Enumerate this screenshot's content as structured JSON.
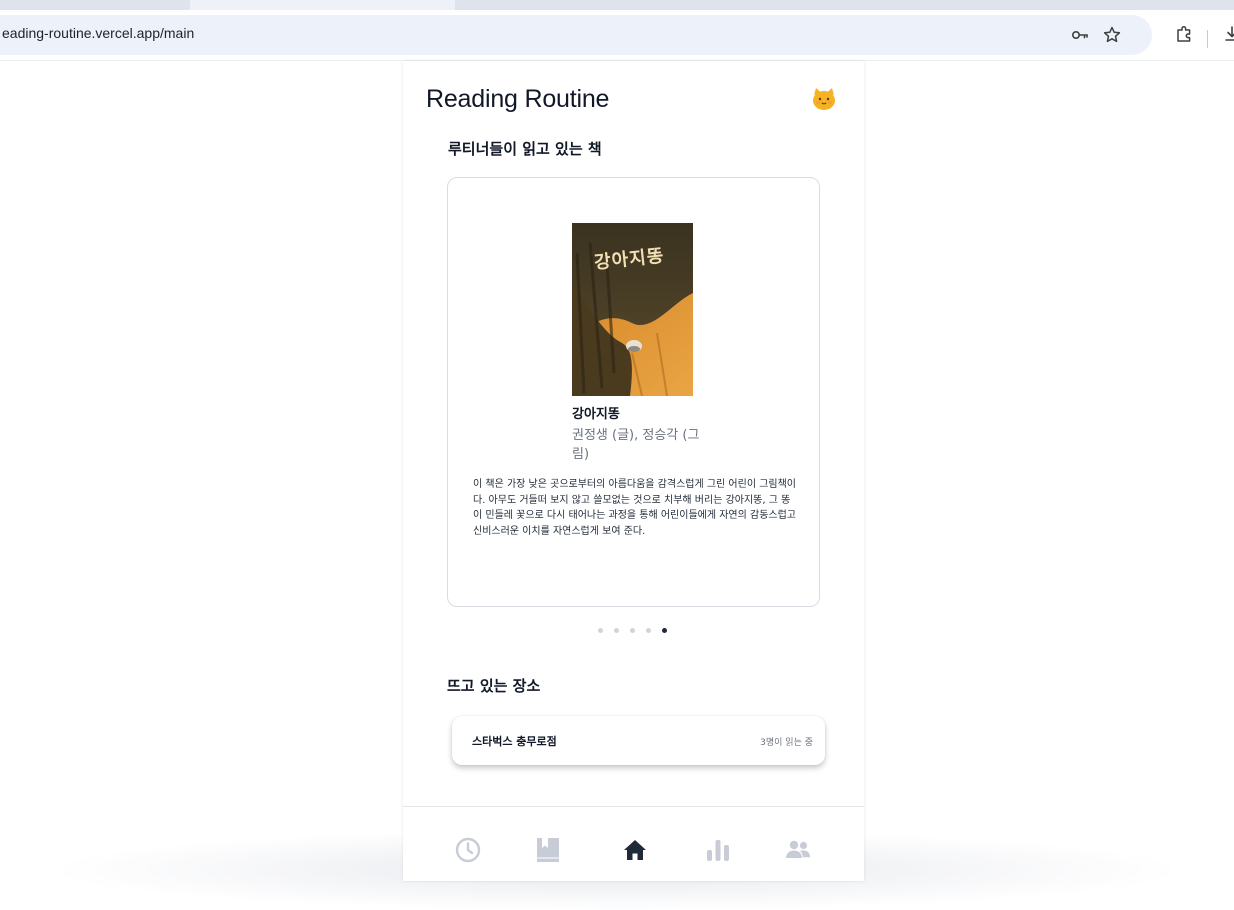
{
  "browser": {
    "url": "eading-routine.vercel.app/main",
    "icons": [
      "key-icon",
      "star-icon",
      "extensions-icon",
      "download-icon"
    ]
  },
  "app": {
    "title": "Reading Routine",
    "avatar_icon": "cat-face-icon",
    "accent_color": "#f5b323"
  },
  "reading_section": {
    "title": "루티너들이 읽고 있는 책",
    "book": {
      "cover_text": "강아지똥",
      "title": "강아지똥",
      "author": "권정생 (글), 정승각 (그림)",
      "description": "이 책은 가장 낮은 곳으로부터의 아름다움을 감격스럽게 그린 어린이 그림책이다. 아무도 거들떠 보지 않고 쓸모없는 것으로 치부해 버리는 강아지똥, 그 똥이 민들레 꽃으로 다시 태어나는 과정을 통해 어린이들에게 자연의 감동스럽고 신비스러운 이치를 자연스럽게 보여 준다."
    },
    "carousel": {
      "total": 5,
      "active_index": 4
    }
  },
  "places_section": {
    "title": "뜨고 있는 장소",
    "places": [
      {
        "name": "스타벅스 충무로점",
        "status": "3명이 읽는 중"
      }
    ]
  },
  "bottom_nav": {
    "items": [
      {
        "icon": "clock-icon",
        "active": false
      },
      {
        "icon": "bookmark-book-icon",
        "active": false
      },
      {
        "icon": "home-icon",
        "active": true
      },
      {
        "icon": "bar-chart-icon",
        "active": false
      },
      {
        "icon": "users-icon",
        "active": false
      }
    ],
    "active_color": "#1f2937",
    "inactive_color": "#c7ccd6"
  }
}
